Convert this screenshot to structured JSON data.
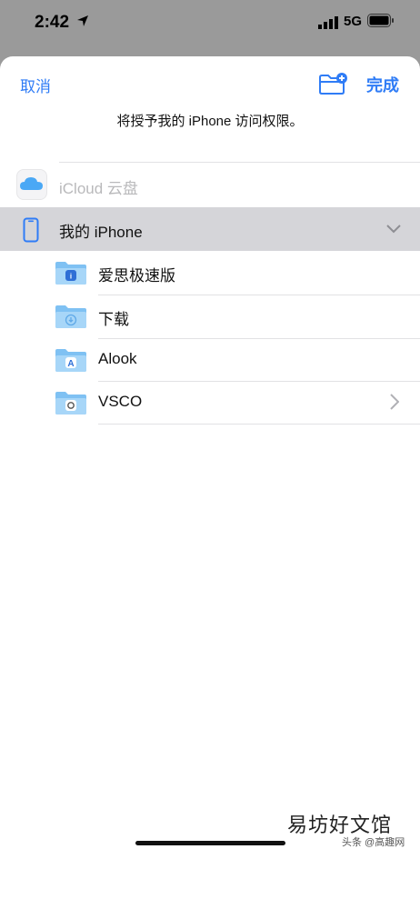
{
  "status_bar": {
    "time": "2:42",
    "network": "5G",
    "icons": [
      "location-arrow-icon",
      "signal-icon",
      "battery-icon"
    ]
  },
  "sheet": {
    "cancel_label": "取消",
    "done_label": "完成",
    "new_folder_icon": "folder-plus-icon",
    "prompt": "将授予我的 iPhone 访问权限。"
  },
  "locations": {
    "icloud": {
      "label": "iCloud 云盘",
      "icon": "cloud-icon"
    },
    "iphone": {
      "label": "我的 iPhone",
      "icon": "iphone-icon",
      "expanded": true
    }
  },
  "folders": [
    {
      "name": "爱思极速版",
      "badge": "i4"
    },
    {
      "name": "下载",
      "badge": "download"
    },
    {
      "name": "Alook",
      "badge": "A"
    },
    {
      "name": "VSCO",
      "badge": "circle",
      "has_disclosure": true
    }
  ],
  "watermark": {
    "main": "易坊好文馆",
    "sub": "头条 @高趣网"
  },
  "colors": {
    "accent": "#2f7cf6",
    "folder": "#7fc1f3",
    "selected_row": "#d5d5d9"
  }
}
